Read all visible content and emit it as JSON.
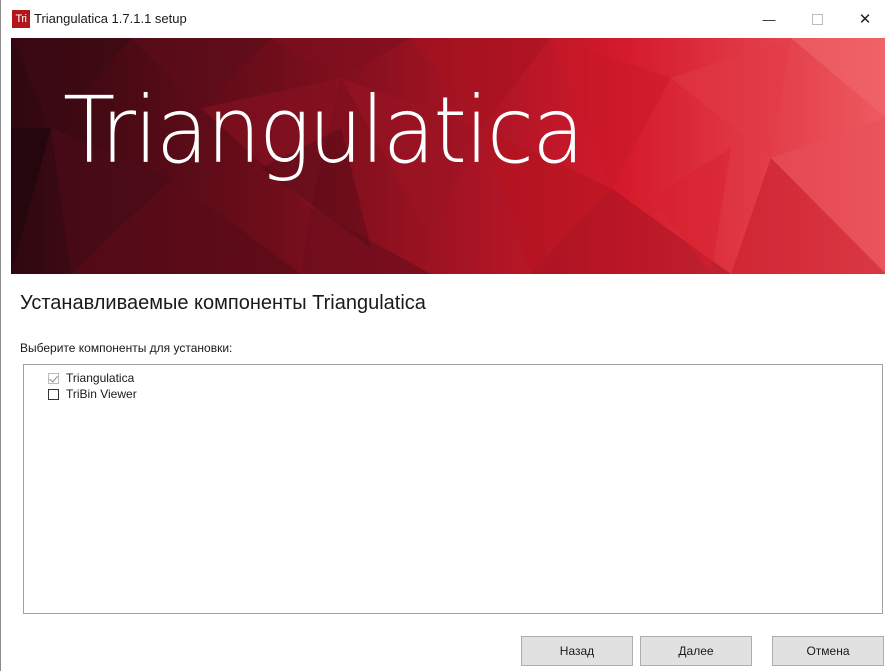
{
  "window": {
    "app_icon_text": "Tri",
    "title": "Triangulatica 1.7.1.1 setup",
    "minimize_glyph": "—",
    "close_glyph": "✕"
  },
  "banner": {
    "title": "Triangulatica"
  },
  "page": {
    "heading": "Устанавливаемые компоненты Triangulatica",
    "subheading": "Выберите компоненты для установки:"
  },
  "components": [
    {
      "label": "Triangulatica",
      "checked": true,
      "disabled": true
    },
    {
      "label": "TriBin Viewer",
      "checked": false,
      "disabled": false
    }
  ],
  "buttons": {
    "back": "Назад",
    "next": "Далее",
    "cancel": "Отмена"
  },
  "colors": {
    "brand_red": "#b0161c",
    "banner_dark": "#3a0a12",
    "banner_bright": "#e8243a"
  }
}
